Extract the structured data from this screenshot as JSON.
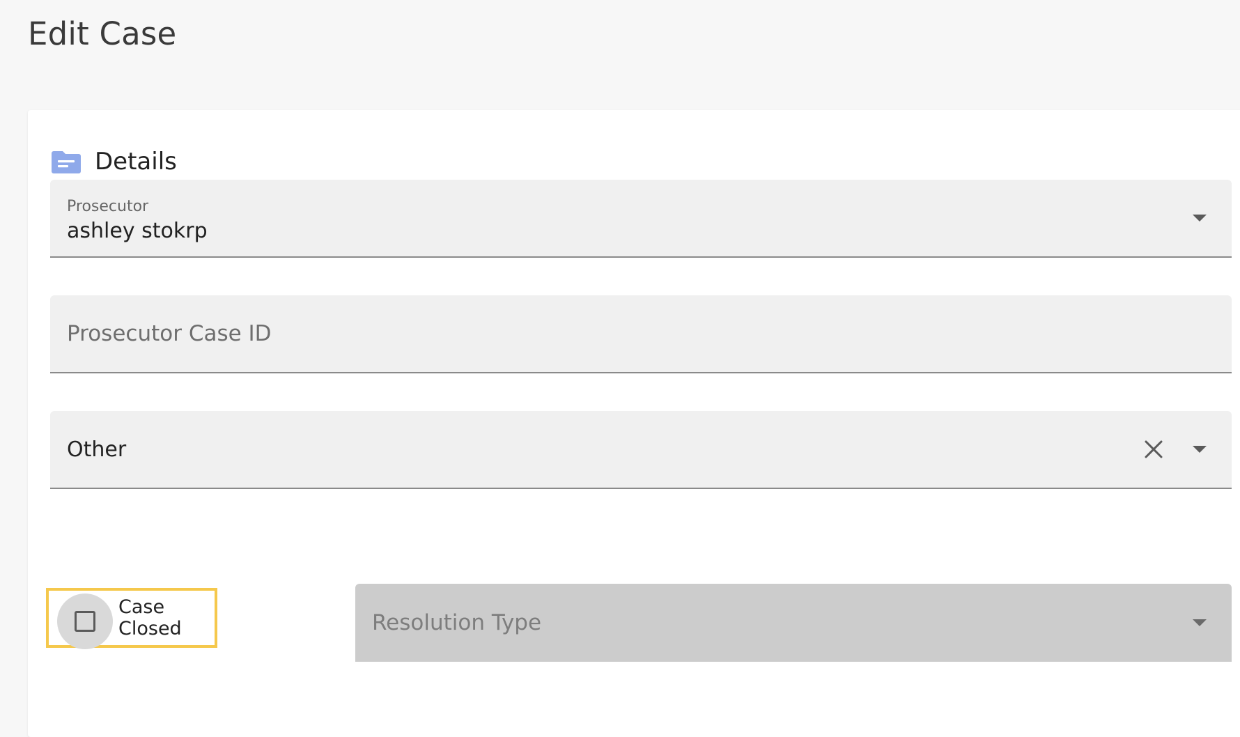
{
  "page": {
    "title": "Edit Case"
  },
  "details": {
    "section_title": "Details",
    "icon": "folder-icon",
    "prosecutor": {
      "label": "Prosecutor",
      "value": "ashley stokrp"
    },
    "prosecutor_case_id": {
      "placeholder": "Prosecutor Case ID",
      "value": ""
    },
    "category_select": {
      "value": "Other"
    },
    "case_closed": {
      "label": "Case Closed",
      "checked": false
    },
    "resolution_type": {
      "placeholder": "Resolution Type",
      "disabled": true
    }
  },
  "colors": {
    "folder_icon": "#8fa9ea",
    "highlight_border": "#f5c84c",
    "field_bg": "#f0f0f0",
    "disabled_bg": "#cccccc"
  }
}
